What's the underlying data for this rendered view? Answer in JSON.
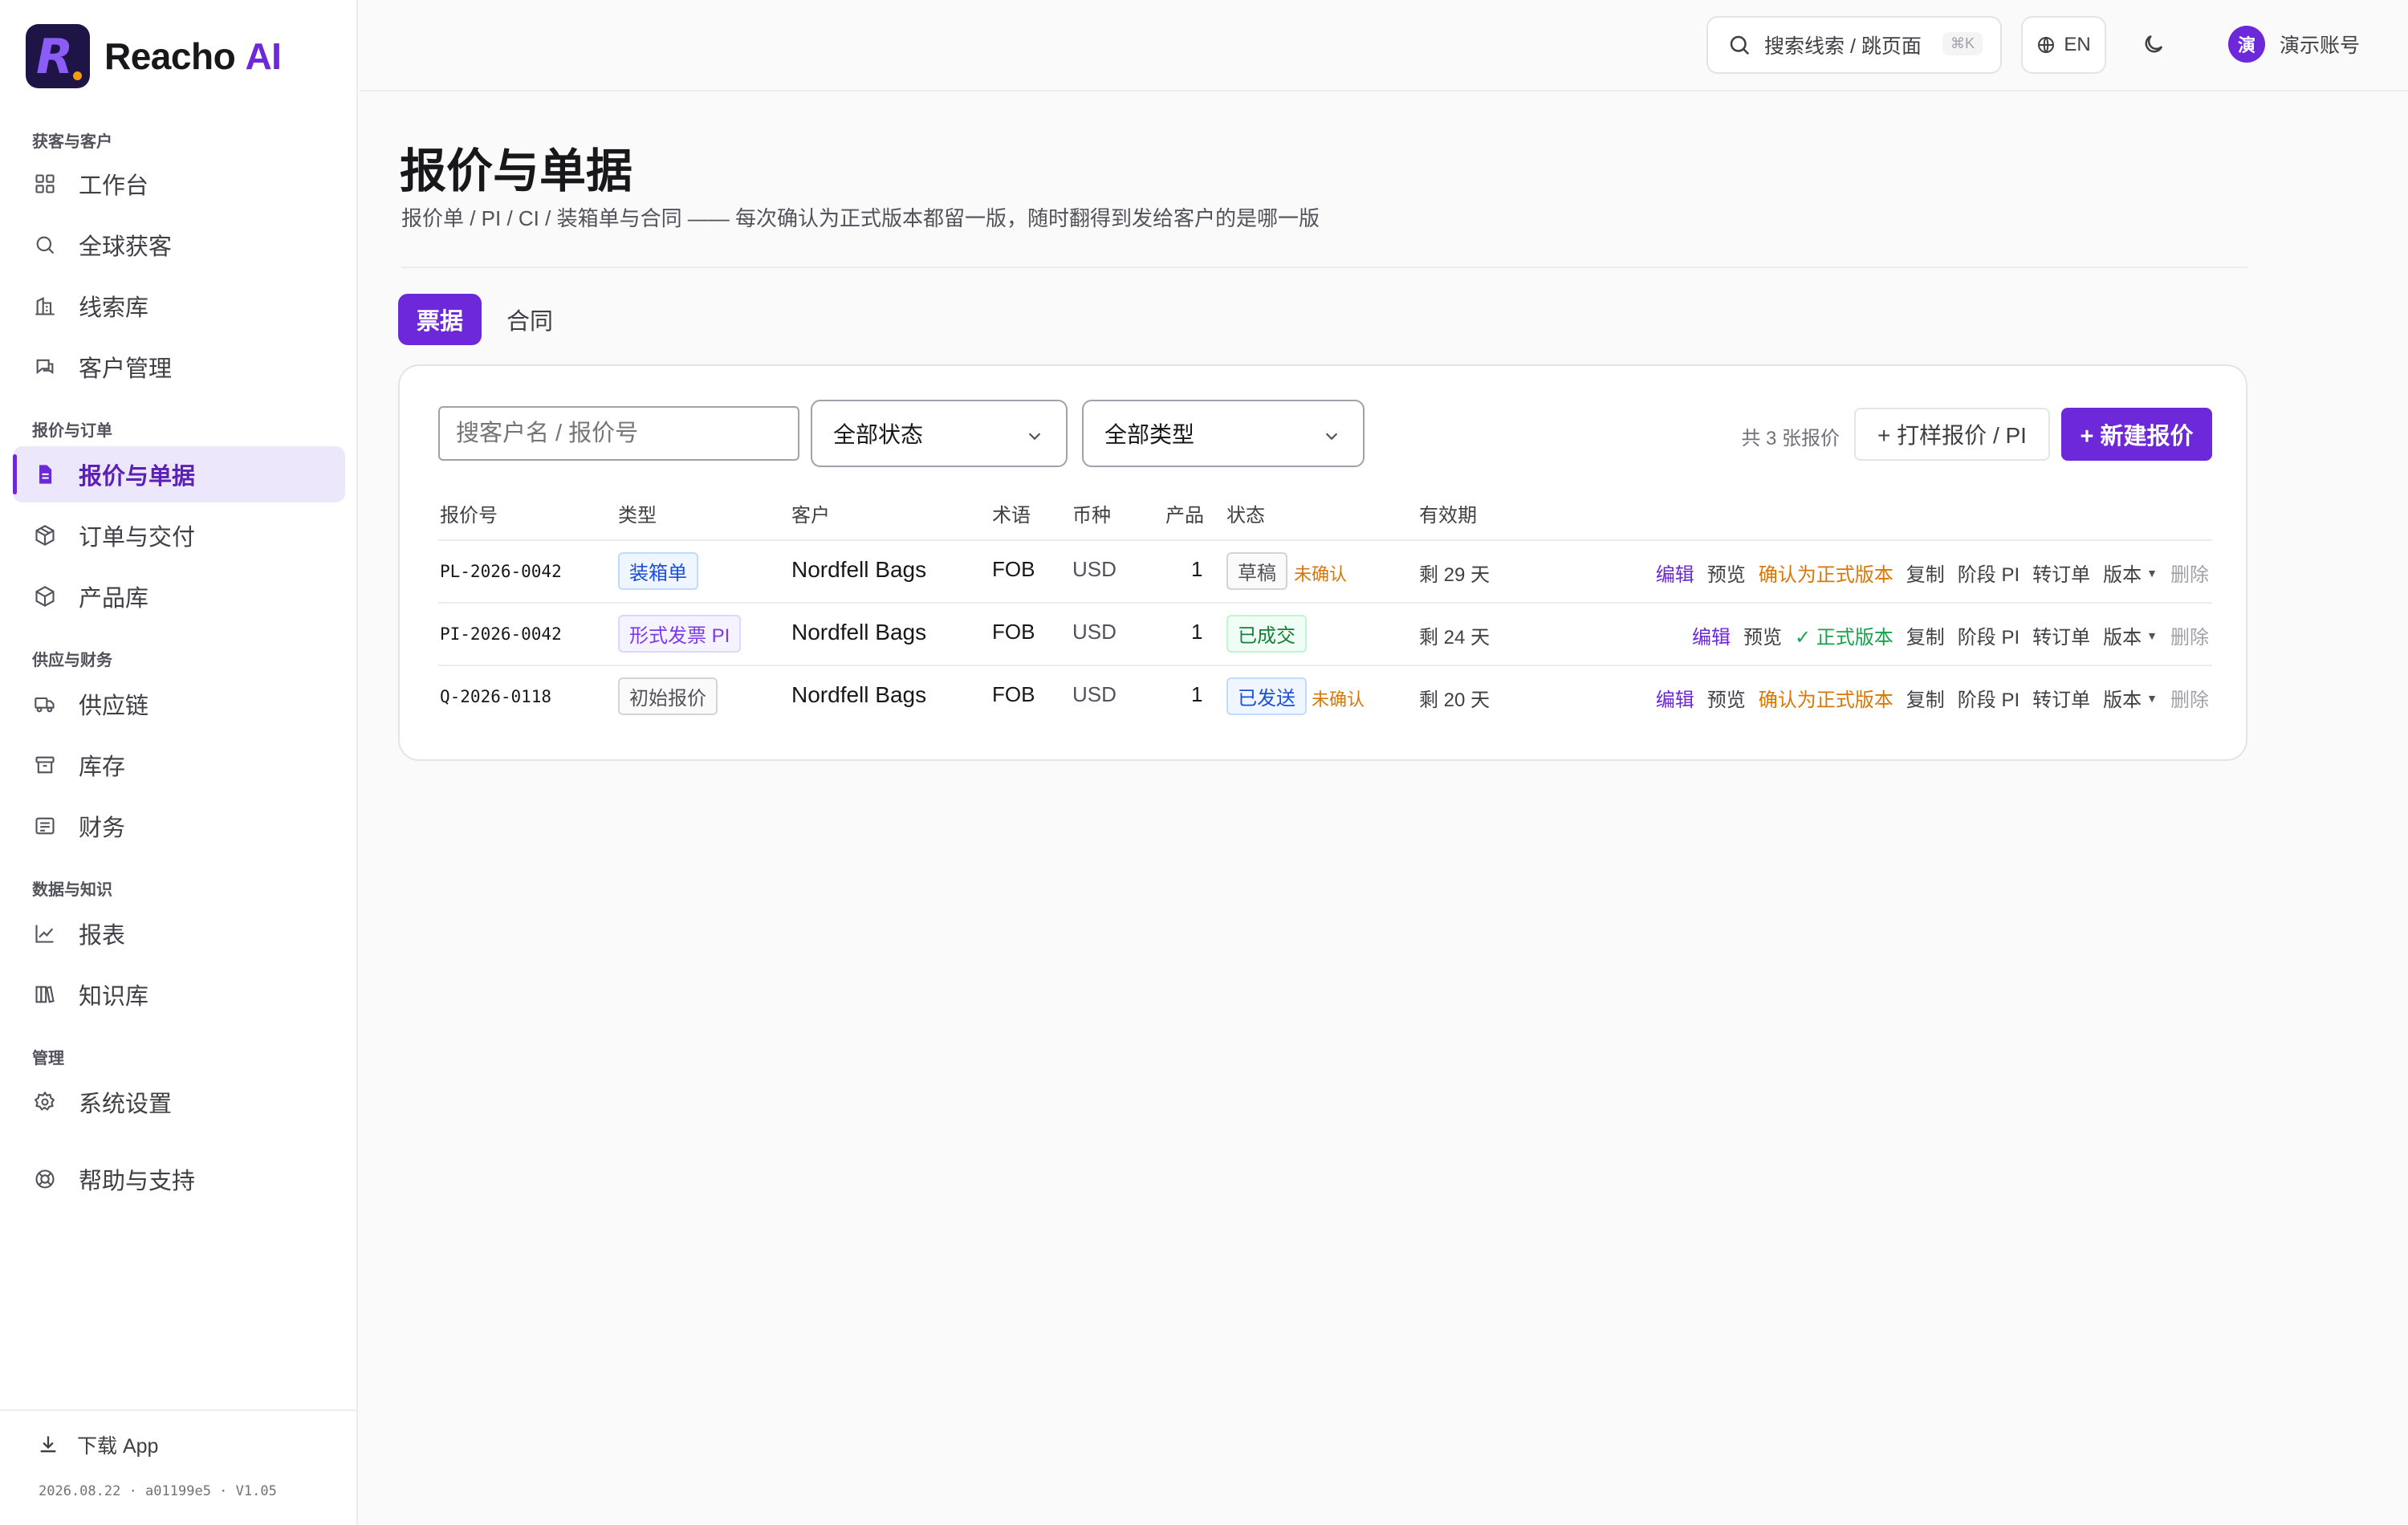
{
  "brand": {
    "name_prefix": "Reacho",
    "name_suffix": "AI",
    "mark_letter": "R"
  },
  "sidebar": {
    "sections": [
      {
        "title": "获客与客户"
      },
      {
        "title": "报价与订单"
      },
      {
        "title": "供应与财务"
      },
      {
        "title": "数据与知识"
      },
      {
        "title": "管理"
      }
    ],
    "items": [
      {
        "label": "工作台",
        "icon": "grid-icon"
      },
      {
        "label": "全球获客",
        "icon": "search-icon"
      },
      {
        "label": "线索库",
        "icon": "building-icon"
      },
      {
        "label": "客户管理",
        "icon": "chat-icon"
      },
      {
        "label": "报价与单据",
        "icon": "document-icon",
        "active": true
      },
      {
        "label": "订单与交付",
        "icon": "box-icon"
      },
      {
        "label": "产品库",
        "icon": "cube-icon"
      },
      {
        "label": "供应链",
        "icon": "truck-icon"
      },
      {
        "label": "库存",
        "icon": "archive-icon"
      },
      {
        "label": "财务",
        "icon": "receipt-icon"
      },
      {
        "label": "报表",
        "icon": "chart-icon"
      },
      {
        "label": "知识库",
        "icon": "books-icon"
      },
      {
        "label": "系统设置",
        "icon": "gear-icon"
      },
      {
        "label": "帮助与支持",
        "icon": "lifebuoy-icon"
      }
    ],
    "download_label": "下载 App",
    "version": "2026.08.22 · a01199e5 · V1.05"
  },
  "topbar": {
    "search_label": "搜索线索 / 跳页面",
    "search_shortcut": "⌘K",
    "lang_label": "EN",
    "avatar_letter": "演",
    "account_label": "演示账号"
  },
  "page": {
    "title": "报价与单据",
    "subtitle": "报价单 / PI / CI / 装箱单与合同 —— 每次确认为正式版本都留一版，随时翻得到发给客户的是哪一版",
    "tabs": [
      {
        "label": "票据",
        "active": true
      },
      {
        "label": "合同"
      }
    ]
  },
  "filters": {
    "search_placeholder": "搜客户名 / 报价号",
    "status_value": "全部状态",
    "type_value": "全部类型",
    "count_text": "共 3 张报价",
    "batch_button": "+ 打样报价 / PI",
    "new_button": "+ 新建报价"
  },
  "table": {
    "headers": [
      "报价号",
      "类型",
      "客户",
      "术语",
      "币种",
      "产品",
      "状态",
      "有效期"
    ],
    "rows": [
      {
        "id": "PL-2026-0042",
        "type": "装箱单",
        "customer": "Nordfell Bags",
        "term": "FOB",
        "currency": "USD",
        "products": "1",
        "status": "草稿",
        "flag": "未确认",
        "validity": "剩 29 天",
        "actions": {
          "edit": "编辑",
          "preview": "预览",
          "confirm": "确认为正式版本",
          "copy": "复制",
          "stage": "阶段 PI",
          "convert": "转订单",
          "version": "版本",
          "delete": "删除"
        }
      },
      {
        "id": "PI-2026-0042",
        "type": "形式发票 PI",
        "customer": "Nordfell Bags",
        "term": "FOB",
        "currency": "USD",
        "products": "1",
        "status": "已成交",
        "flag": "",
        "validity": "剩 24 天",
        "actions": {
          "edit": "编辑",
          "preview": "预览",
          "confirm": "✓ 正式版本",
          "copy": "复制",
          "stage": "阶段 PI",
          "convert": "转订单",
          "version": "版本",
          "delete": "删除"
        }
      },
      {
        "id": "Q-2026-0118",
        "type": "初始报价",
        "customer": "Nordfell Bags",
        "term": "FOB",
        "currency": "USD",
        "products": "1",
        "status": "已发送",
        "flag": "未确认",
        "validity": "剩 20 天",
        "actions": {
          "edit": "编辑",
          "preview": "预览",
          "confirm": "确认为正式版本",
          "copy": "复制",
          "stage": "阶段 PI",
          "convert": "转订单",
          "version": "版本",
          "delete": "删除"
        }
      }
    ]
  },
  "colors": {
    "accent": "#6d28d9",
    "warning": "#d97706",
    "success": "#16a34a"
  }
}
